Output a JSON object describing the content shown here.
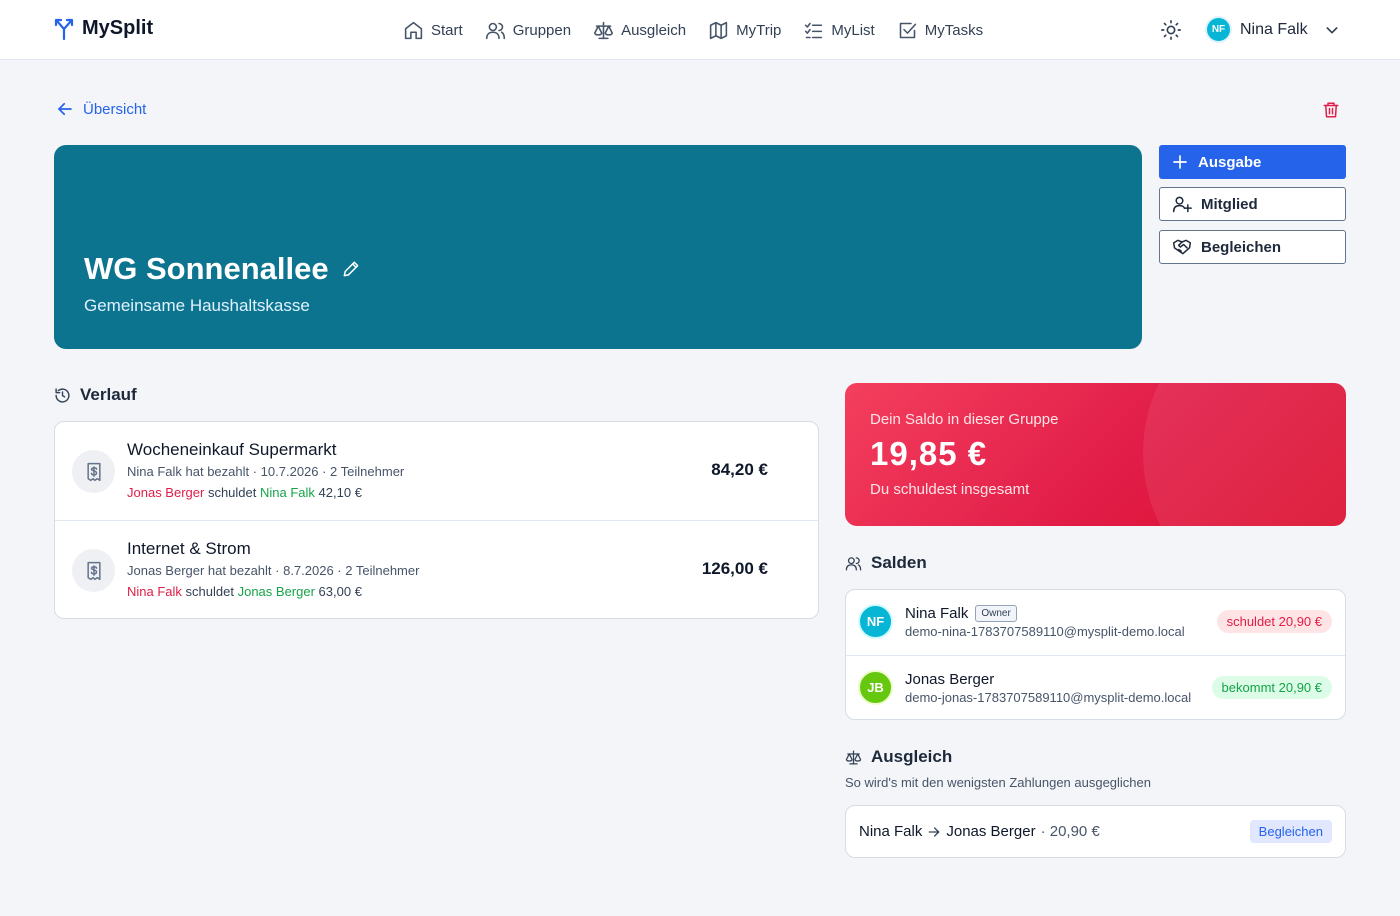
{
  "brand": {
    "name": "MySplit"
  },
  "nav": [
    {
      "label": "Start",
      "icon": "home-icon"
    },
    {
      "label": "Gruppen",
      "icon": "users-icon"
    },
    {
      "label": "Ausgleich",
      "icon": "scale-icon"
    },
    {
      "label": "MyTrip",
      "icon": "map-icon"
    },
    {
      "label": "MyList",
      "icon": "checklist-icon"
    },
    {
      "label": "MyTasks",
      "icon": "checkbox-icon"
    }
  ],
  "user": {
    "initials": "NF",
    "name": "Nina Falk"
  },
  "back": {
    "label": "Übersicht"
  },
  "group": {
    "title": "WG Sonnenallee",
    "subtitle": "Gemeinsame Haushaltskasse",
    "color": "#0d7490"
  },
  "actions": {
    "add_expense": "Ausgabe",
    "add_member": "Mitglied",
    "settle": "Begleichen"
  },
  "history": {
    "title": "Verlauf",
    "items": [
      {
        "title": "Wocheneinkauf Supermarkt",
        "meta": "Nina Falk hat bezahlt · 10.7.2026 · 2 Teilnehmer",
        "debtor": "Jonas Berger",
        "verb": "schuldet",
        "creditor": "Nina Falk",
        "debt_amount": "42,10 €",
        "amount": "84,20 €"
      },
      {
        "title": "Internet & Strom",
        "meta": "Jonas Berger hat bezahlt · 8.7.2026 · 2 Teilnehmer",
        "debtor": "Nina Falk",
        "verb": "schuldet",
        "creditor": "Jonas Berger",
        "debt_amount": "63,00 €",
        "amount": "126,00 €"
      }
    ]
  },
  "balance": {
    "label": "Dein Saldo in dieser Gruppe",
    "value": "19,85 €",
    "sub": "Du schuldest insgesamt"
  },
  "members": {
    "title": "Salden",
    "items": [
      {
        "initials": "NF",
        "name": "Nina Falk",
        "badge": "Owner",
        "email": "demo-nina-1783707589110@mysplit-demo.local",
        "status": "schuldet 20,90 €",
        "avatar_color": "#06b6d4"
      },
      {
        "initials": "JB",
        "name": "Jonas Berger",
        "email": "demo-jonas-1783707589110@mysplit-demo.local",
        "status": "bekommt 20,90 €",
        "avatar_color": "#65c80f"
      }
    ]
  },
  "settlement": {
    "title": "Ausgleich",
    "subtitle": "So wird's mit den wenigsten Zahlungen ausgeglichen",
    "from": "Nina Falk",
    "to": "Jonas Berger",
    "amount": "· 20,90 €",
    "button": "Begleichen"
  },
  "colors": {
    "primary": "#2563eb",
    "danger": "#e11d48",
    "success": "#16a34a"
  }
}
